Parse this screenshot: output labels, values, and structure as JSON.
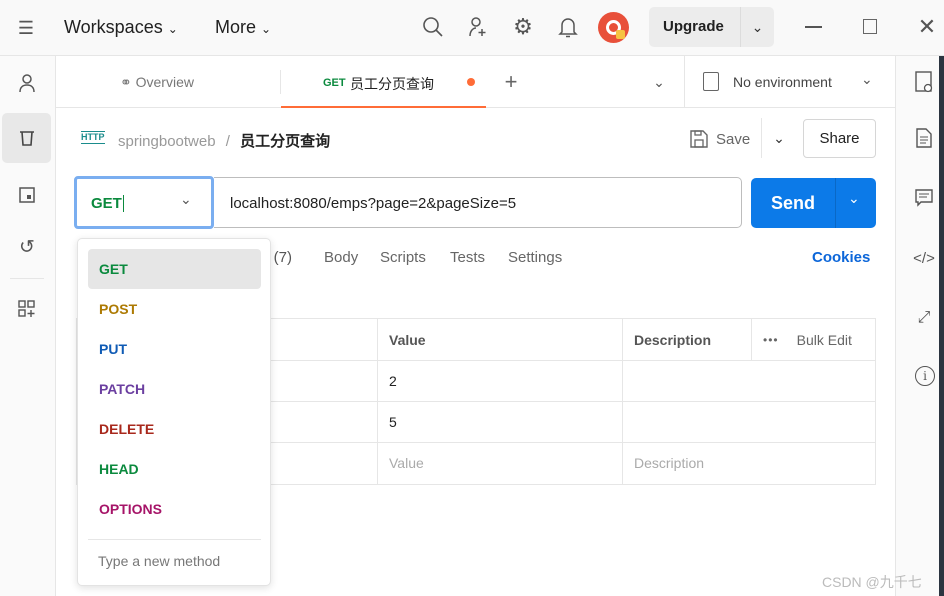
{
  "topbar": {
    "workspaces": "Workspaces",
    "more": "More",
    "upgrade": "Upgrade"
  },
  "tabs": {
    "overview": "Overview",
    "active_method": "GET",
    "active_name": "员工分页查询",
    "environment": "No environment"
  },
  "breadcrumb": {
    "collection": "springbootweb",
    "separator": "/",
    "request": "员工分页查询",
    "http_badge": "HTTP"
  },
  "actions": {
    "save": "Save",
    "share": "Share"
  },
  "request": {
    "method": "GET",
    "url": "localhost:8080/emps?page=2&pageSize=5",
    "send": "Send"
  },
  "subtabs": {
    "headers": "s (7)",
    "body": "Body",
    "scripts": "Scripts",
    "tests": "Tests",
    "settings": "Settings",
    "cookies": "Cookies"
  },
  "table": {
    "headers": {
      "value": "Value",
      "description": "Description",
      "bulk_edit": "Bulk Edit"
    },
    "rows": [
      {
        "value": "2"
      },
      {
        "value": "5"
      }
    ],
    "placeholder": {
      "value": "Value",
      "description": "Description"
    }
  },
  "method_menu": {
    "items": [
      {
        "label": "GET",
        "color": "#0b8a3e"
      },
      {
        "label": "POST",
        "color": "#ad7a03"
      },
      {
        "label": "PUT",
        "color": "#0f5bb5"
      },
      {
        "label": "PATCH",
        "color": "#6b3fa0"
      },
      {
        "label": "DELETE",
        "color": "#a8281c"
      },
      {
        "label": "HEAD",
        "color": "#0b8a3e"
      },
      {
        "label": "OPTIONS",
        "color": "#a61468"
      }
    ],
    "new_method_placeholder": "Type a new method"
  },
  "watermark": "CSDN @九千七",
  "colors": {
    "accent": "#0c7ae8",
    "tab_indicator": "#ff6c37",
    "link": "#0c66d9"
  }
}
